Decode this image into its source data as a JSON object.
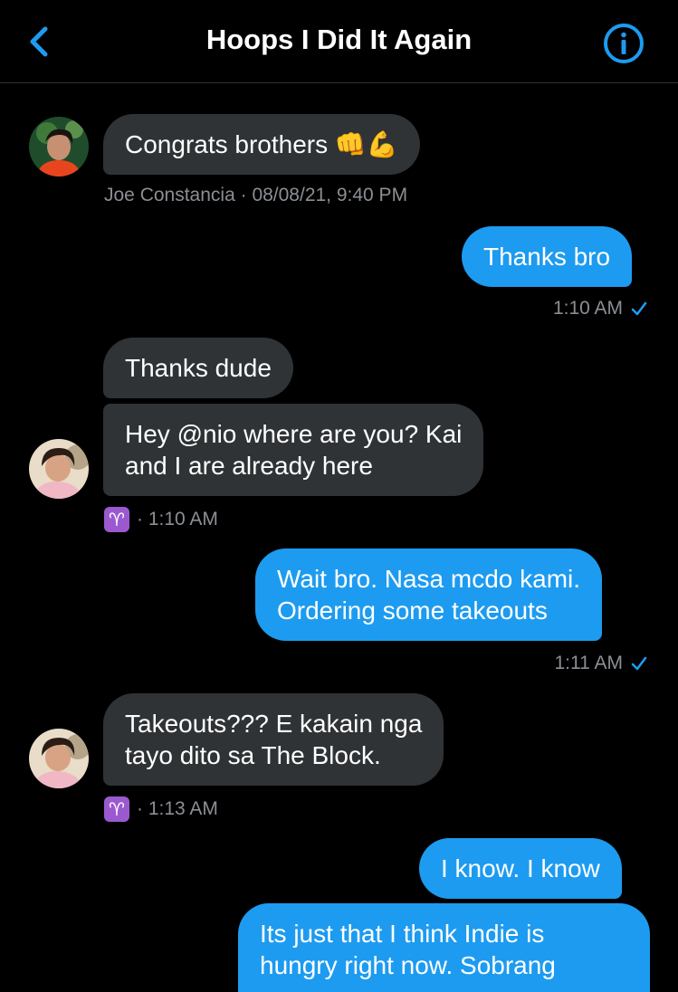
{
  "header": {
    "title": "Hoops I Did It Again",
    "back_icon": "chevron-left-icon",
    "info_icon": "info-icon",
    "accent": "#1d9bf0"
  },
  "messages": [
    {
      "dir": "received",
      "text": "Congrats brothers 👊💪"
    },
    {
      "dir": "received-meta",
      "sender": "Joe Constancia",
      "time": "08/08/21, 9:40 PM"
    },
    {
      "dir": "sent",
      "text": "Thanks bro"
    },
    {
      "dir": "sent-meta",
      "time": "1:10 AM"
    },
    {
      "dir": "received",
      "text": "Thanks dude"
    },
    {
      "dir": "received",
      "line1": "Hey @nio where are you? Kai",
      "line2": "and I are already here"
    },
    {
      "dir": "received-meta",
      "badge": "♈",
      "time": "1:10 AM"
    },
    {
      "dir": "sent",
      "line1": "Wait bro. Nasa mcdo kami.",
      "line2": "Ordering some takeouts"
    },
    {
      "dir": "sent-meta",
      "time": "1:11 AM"
    },
    {
      "dir": "received",
      "line1": "Takeouts??? E kakain nga",
      "line2": "tayo dito sa The Block."
    },
    {
      "dir": "received-meta",
      "badge": "♈",
      "time": "1:13 AM"
    },
    {
      "dir": "sent",
      "text": "I know. I know"
    },
    {
      "dir": "sent",
      "line1": "Its just that I think Indie is",
      "line2": "hungry right now. Sobrang"
    }
  ]
}
